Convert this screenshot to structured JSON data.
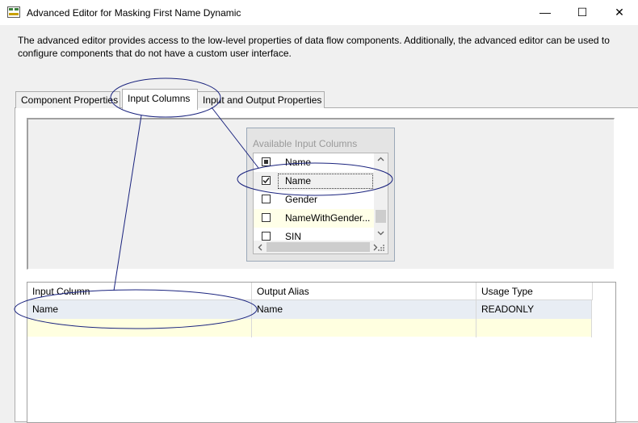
{
  "window": {
    "title": "Advanced Editor for Masking First Name Dynamic",
    "minimize_glyph": "—",
    "maximize_glyph": "☐",
    "close_glyph": "✕"
  },
  "description": "The advanced editor provides access to the low-level properties of data flow components. Additionally, the advanced editor can be used to configure components that do not have a custom user interface.",
  "tabs": [
    {
      "label": "Component Properties",
      "active": false
    },
    {
      "label": "Input Columns",
      "active": true
    },
    {
      "label": "Input and Output Properties",
      "active": false
    }
  ],
  "available_columns": {
    "header": "Available Input Columns",
    "items": [
      {
        "label": "Name",
        "state": "indeterminate"
      },
      {
        "label": "Name",
        "state": "checked"
      },
      {
        "label": "Gender",
        "state": "unchecked"
      },
      {
        "label": "NameWithGender...",
        "state": "unchecked"
      },
      {
        "label": "SIN",
        "state": "unchecked"
      }
    ]
  },
  "grid": {
    "headers": [
      "Input Column",
      "Output Alias",
      "Usage Type"
    ],
    "rows": [
      [
        "Name",
        "Name",
        "READONLY"
      ],
      [
        "",
        "",
        ""
      ]
    ]
  },
  "colors": {
    "accent": "#0000ff",
    "annotation": "#1a237e",
    "selected_row": "#e8edf4",
    "new_row": "#ffffe0"
  }
}
